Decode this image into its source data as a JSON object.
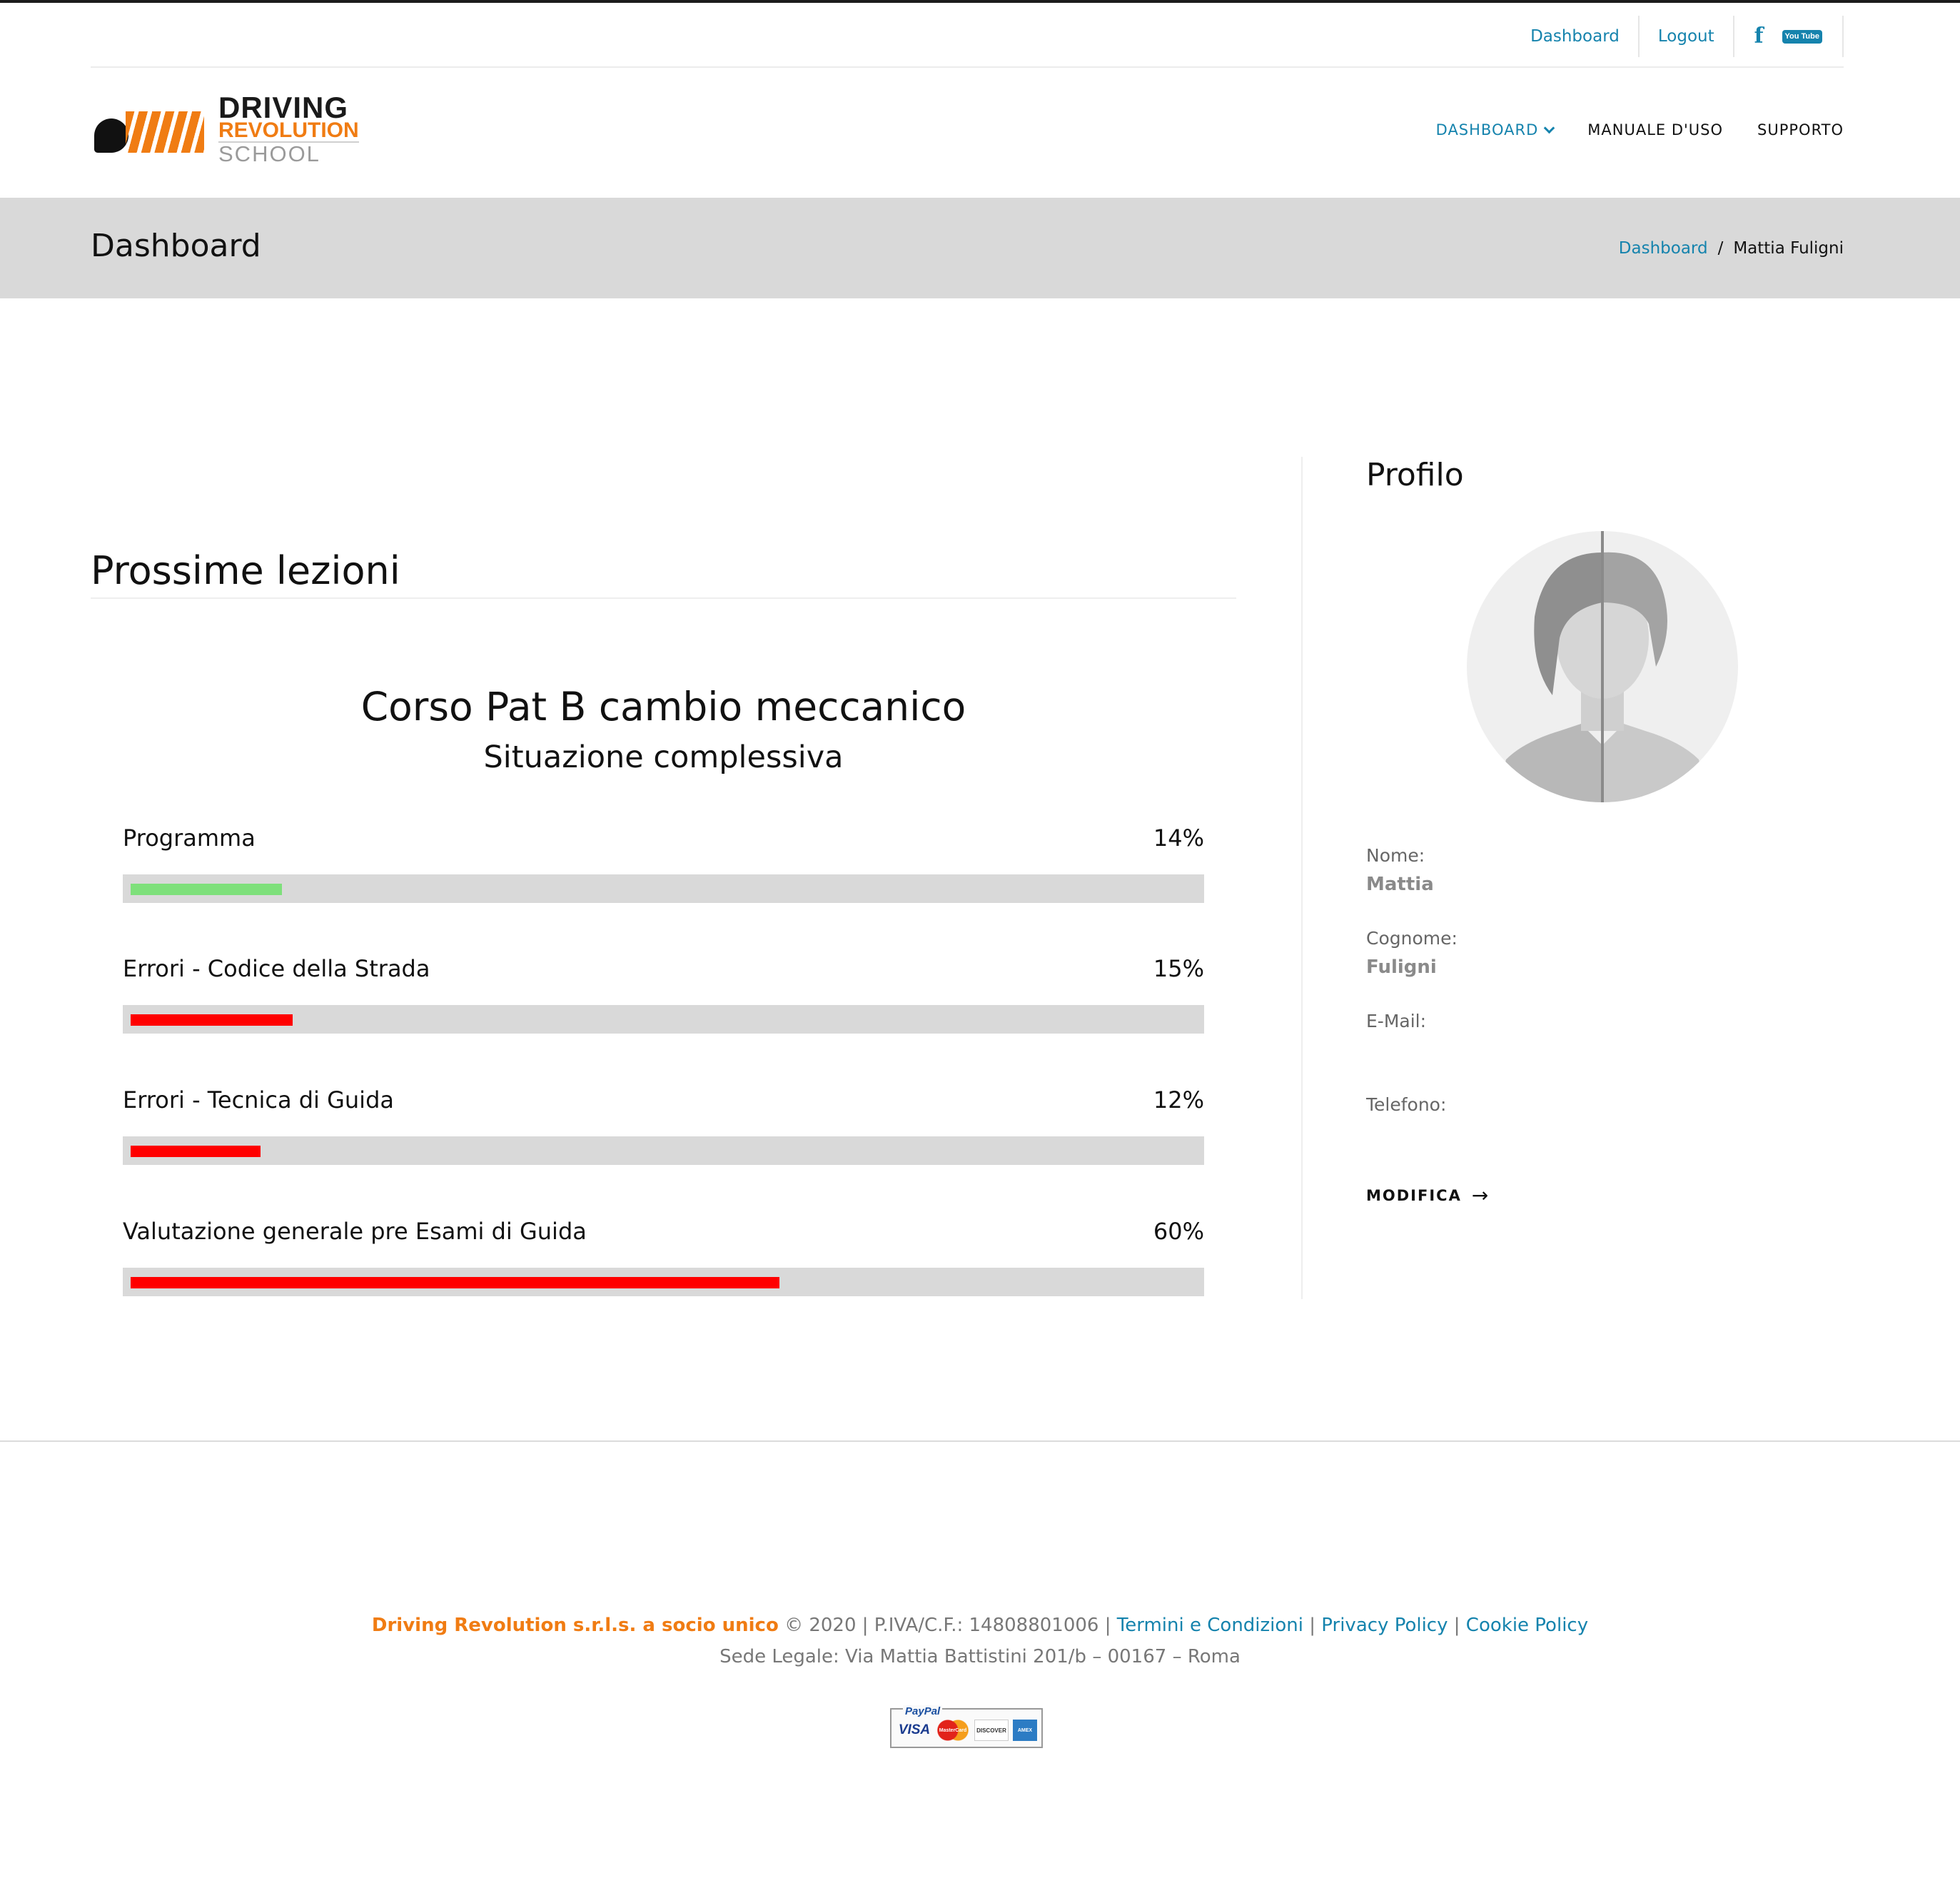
{
  "top_links": {
    "dashboard": "Dashboard",
    "logout": "Logout"
  },
  "social": {
    "facebook_glyph": "f",
    "youtube_glyph": "You Tube"
  },
  "logo": {
    "line1": "DRIVING",
    "line2": "REVOLUTION",
    "line3": "SCHOOL"
  },
  "main_nav": {
    "items": [
      "DASHBOARD",
      "MANUALE D'USO",
      "SUPPORTO"
    ]
  },
  "page_title": "Dashboard",
  "breadcrumb": {
    "home": "Dashboard",
    "separator": "/",
    "current": "Mattia Fuligni"
  },
  "lessons": {
    "title": "Prossime lezioni",
    "course_title": "Corso Pat B cambio meccanico",
    "course_subtitle": "Situazione complessiva",
    "progress": [
      {
        "label": "Programma",
        "value_text": "14%",
        "value": 14,
        "color": "#7ee07b"
      },
      {
        "label": "Errori - Codice della Strada",
        "value_text": "15%",
        "value": 15,
        "color": "#ff0000"
      },
      {
        "label": "Errori - Tecnica di Guida",
        "value_text": "12%",
        "value": 12,
        "color": "#ff0000"
      },
      {
        "label": "Valutazione generale pre Esami di Guida",
        "value_text": "60%",
        "value": 60,
        "color": "#ff0000"
      }
    ]
  },
  "profile": {
    "title": "Profilo",
    "fields": [
      {
        "label": "Nome:",
        "value": "Mattia"
      },
      {
        "label": "Cognome:",
        "value": "Fuligni"
      },
      {
        "label": "E-Mail:",
        "value": ""
      },
      {
        "label": "Telefono:",
        "value": ""
      }
    ],
    "edit_label": "MODIFICA"
  },
  "footer": {
    "company": "Driving Revolution s.r.l.s. a socio unico",
    "copyright": "© 2020  |  P.IVA/C.F.: 14808801006 |",
    "terms": "Termini e Condizioni",
    "sep1": "|",
    "privacy": "Privacy Policy",
    "sep2": "|",
    "cookie": "Cookie Policy",
    "address": "Sede Legale: Via Mattia Battistini 201/b – 00167 – Roma",
    "payments": {
      "paypal": "PayPal",
      "visa": "VISA",
      "mastercard": "MasterCard",
      "discover": "DISCOVER",
      "amex": "AMEX"
    }
  },
  "colors": {
    "accent": "#1583ad",
    "brand_orange": "#f07c13",
    "title_bar": "#d9d9d9"
  }
}
